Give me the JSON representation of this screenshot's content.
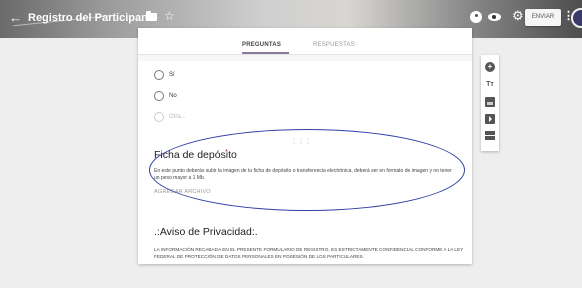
{
  "header": {
    "back_icon": "←",
    "title": "Registro del Participante",
    "star_icon": "☆",
    "gear_icon": "⚙",
    "send_label": "ENVIAR",
    "more_icon": "⋮"
  },
  "tabs": [
    {
      "label": "PREGUNTAS"
    },
    {
      "label": "RESPUESTAS"
    }
  ],
  "options": [
    {
      "label": "Sí"
    },
    {
      "label": "No"
    },
    {
      "label": "Otra..."
    }
  ],
  "drag_handle": "⋮⋮⋮",
  "question": {
    "title": "Ficha de depósito",
    "required_mark": "*",
    "description": "En este punto deberás subir la imagen de tu ficha de depósito o transferencia electrónica, deberá ser en formato de imagen y no tener un peso mayor a 1 Mb.",
    "upload_label": "AGREGAR ARCHIVO"
  },
  "privacy": {
    "title": ".:Aviso de Privacidad:.",
    "text": "LA INFORMACIÓN RECABADA EN EL PRESENTE FORMULARIO DE REGISTRO, ES ESTRICTAMENTE CONFIDENCIAL CONFORME A LA LEY FEDERAL DE PROTECCIÓN DE DATOS PERSONALES EN POSESIÓN DE LOS PARTICULARES."
  },
  "toolbar": {
    "add_icon": "+",
    "text_icon": "Tт"
  },
  "colors": {
    "highlight": "#2f3ea3",
    "tab_indicator": "#8a7a9a",
    "required": "#c0392b"
  }
}
